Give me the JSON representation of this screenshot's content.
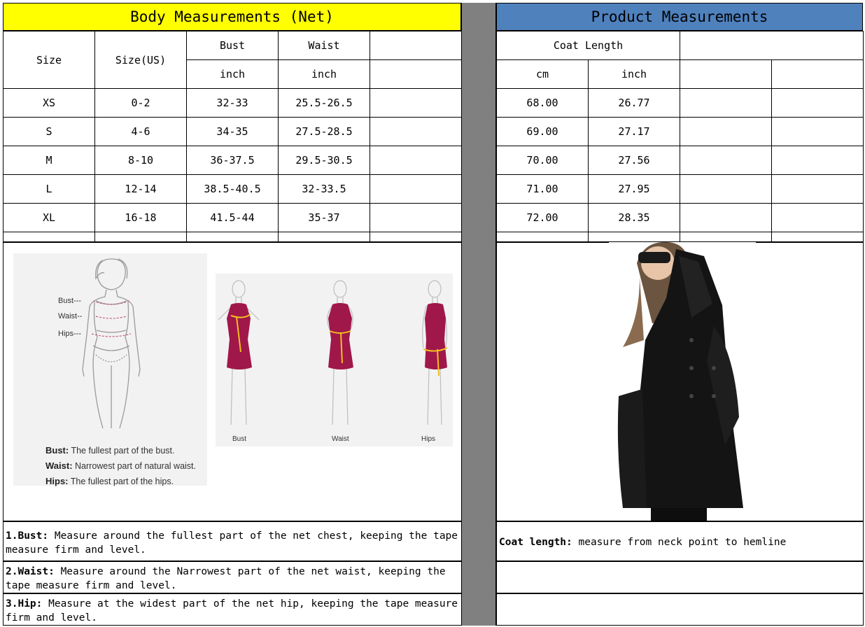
{
  "headers": {
    "body": "Body Measurements (Net)",
    "product": "Product Measurements"
  },
  "body_table": {
    "col_size": "Size",
    "col_size_us": "Size(US)",
    "col_bust": "Bust",
    "col_waist": "Waist",
    "unit_bust": "inch",
    "unit_waist": "inch",
    "rows": [
      {
        "size": "XS",
        "us": "0-2",
        "bust": "32-33",
        "waist": "25.5-26.5"
      },
      {
        "size": "S",
        "us": "4-6",
        "bust": "34-35",
        "waist": "27.5-28.5"
      },
      {
        "size": "M",
        "us": "8-10",
        "bust": "36-37.5",
        "waist": "29.5-30.5"
      },
      {
        "size": "L",
        "us": "12-14",
        "bust": "38.5-40.5",
        "waist": "32-33.5"
      },
      {
        "size": "XL",
        "us": "16-18",
        "bust": "41.5-44",
        "waist": "35-37"
      }
    ]
  },
  "product_table": {
    "col_coat": "Coat Length",
    "unit_cm": "cm",
    "unit_inch": "inch",
    "rows": [
      {
        "cm": "68.00",
        "inch": "26.77"
      },
      {
        "cm": "69.00",
        "inch": "27.17"
      },
      {
        "cm": "70.00",
        "inch": "27.56"
      },
      {
        "cm": "71.00",
        "inch": "27.95"
      },
      {
        "cm": "72.00",
        "inch": "28.35"
      }
    ]
  },
  "figure_left": {
    "labels": [
      "Bust---",
      "Waist--",
      "Hips---"
    ],
    "captions": [
      {
        "term": "Bust:",
        "text": "The fullest part of the bust."
      },
      {
        "term": "Waist:",
        "text": "Narrowest part of natural waist."
      },
      {
        "term": "Hips:",
        "text": "The fullest part of the hips."
      }
    ]
  },
  "figure_dress": {
    "labels": [
      "Bust",
      "Waist",
      "Hips"
    ]
  },
  "notes": {
    "bust_term": "1.Bust:",
    "bust_text": " Measure around the fullest part of the net chest, keeping the tape  measure firm and level.",
    "waist_term": "2.Waist:",
    "waist_text": " Measure around the Narrowest part of the net waist, keeping the tape  measure firm and level.",
    "hip_term": "3.Hip:",
    "hip_text": " Measure at the widest part of the net hip, keeping the tape measure firm and level.",
    "coat_term": "Coat length:",
    "coat_text": " measure from neck point to hemline"
  },
  "colors": {
    "header_yellow": "#ffff00",
    "header_blue": "#4f81bd",
    "divider_gray": "#808080",
    "dress": "#a0174a",
    "tape": "#f0c020"
  }
}
